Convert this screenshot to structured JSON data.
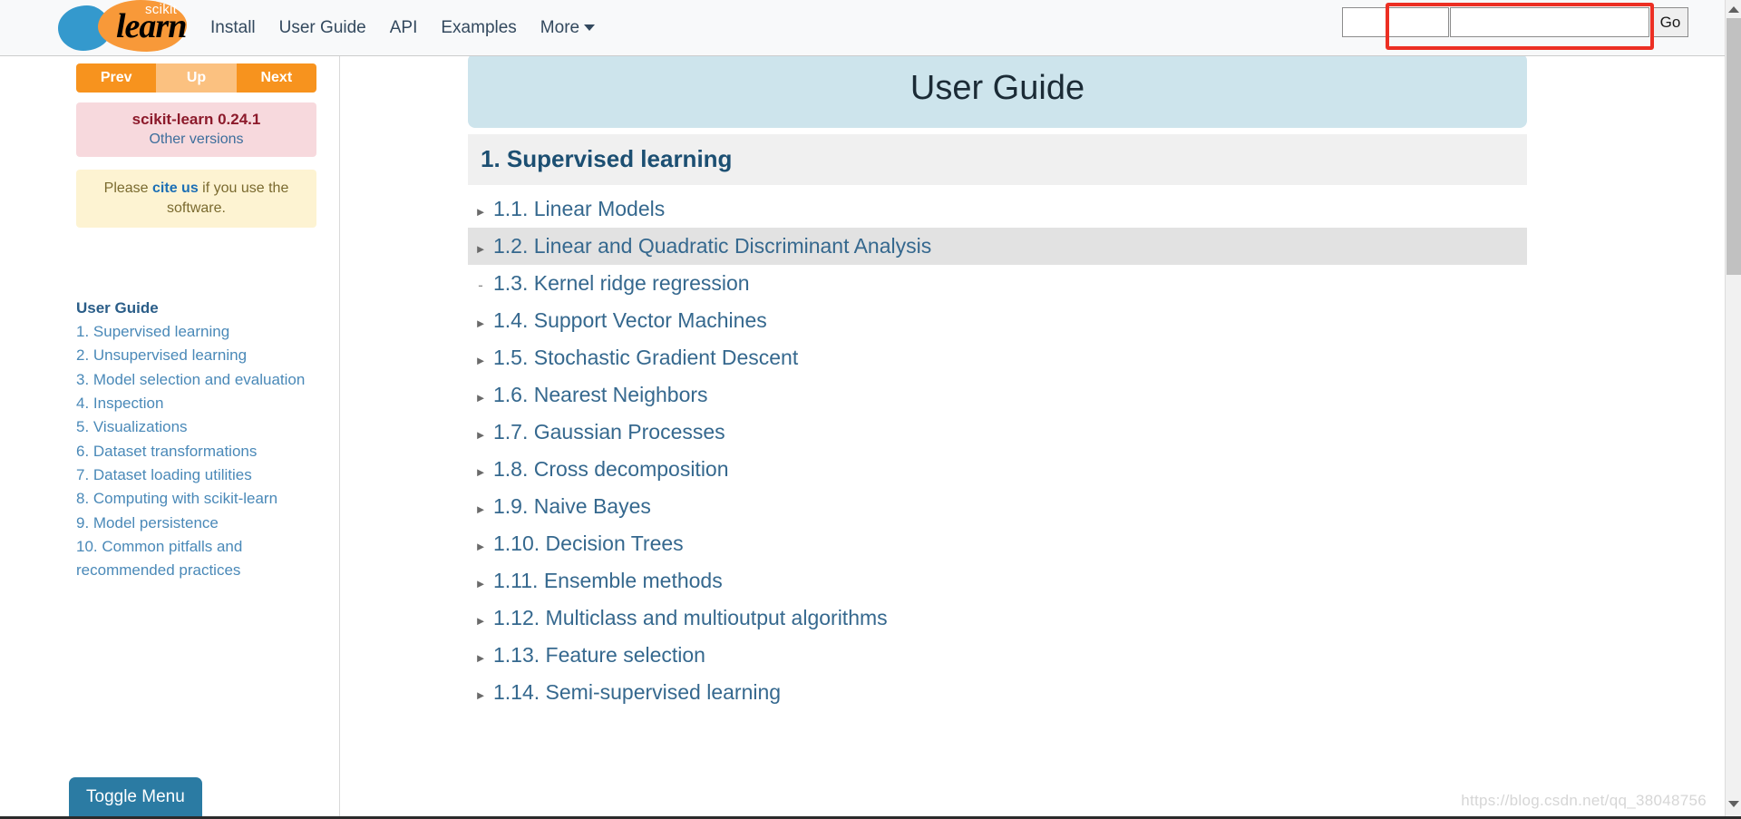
{
  "navbar": {
    "brand": {
      "scikit": "scikit",
      "learn": "learn"
    },
    "links": [
      {
        "label": "Install"
      },
      {
        "label": "User Guide"
      },
      {
        "label": "API"
      },
      {
        "label": "Examples"
      },
      {
        "label": "More"
      }
    ],
    "search": {
      "value": "",
      "placeholder": "",
      "go_label": "Go"
    },
    "annotation_color": "#ec2f23"
  },
  "sidebar": {
    "pager": {
      "prev": "Prev",
      "up": "Up",
      "next": "Next"
    },
    "version": {
      "title": "scikit-learn 0.24.1",
      "other_versions": "Other versions"
    },
    "cite": {
      "before": "Please ",
      "link": "cite us",
      "after": " if you use the software."
    },
    "nav_title": "User Guide",
    "items": [
      {
        "label": "1. Supervised learning"
      },
      {
        "label": "2. Unsupervised learning"
      },
      {
        "label": "3. Model selection and evaluation"
      },
      {
        "label": "4. Inspection"
      },
      {
        "label": "5. Visualizations"
      },
      {
        "label": "6. Dataset transformations"
      },
      {
        "label": "7. Dataset loading utilities"
      },
      {
        "label": "8. Computing with scikit-learn"
      },
      {
        "label": "9. Model persistence"
      },
      {
        "label": "10. Common pitfalls and recommended practices"
      }
    ],
    "toggle_menu": "Toggle Menu"
  },
  "main": {
    "page_title": "User Guide",
    "section_title": "1. Supervised learning",
    "toc": [
      {
        "marker": "►",
        "label": "1.1. Linear Models",
        "active": false
      },
      {
        "marker": "►",
        "label": "1.2. Linear and Quadratic Discriminant Analysis",
        "active": true
      },
      {
        "marker": "-",
        "label": "1.3. Kernel ridge regression",
        "active": false
      },
      {
        "marker": "►",
        "label": "1.4. Support Vector Machines",
        "active": false
      },
      {
        "marker": "►",
        "label": "1.5. Stochastic Gradient Descent",
        "active": false
      },
      {
        "marker": "►",
        "label": "1.6. Nearest Neighbors",
        "active": false
      },
      {
        "marker": "►",
        "label": "1.7. Gaussian Processes",
        "active": false
      },
      {
        "marker": "►",
        "label": "1.8. Cross decomposition",
        "active": false
      },
      {
        "marker": "►",
        "label": "1.9. Naive Bayes",
        "active": false
      },
      {
        "marker": "►",
        "label": "1.10. Decision Trees",
        "active": false
      },
      {
        "marker": "►",
        "label": "1.11. Ensemble methods",
        "active": false
      },
      {
        "marker": "►",
        "label": "1.12. Multiclass and multioutput algorithms",
        "active": false
      },
      {
        "marker": "►",
        "label": "1.13. Feature selection",
        "active": false
      },
      {
        "marker": "►",
        "label": "1.14. Semi-supervised learning",
        "active": false
      }
    ]
  },
  "watermark": "https://blog.csdn.net/qq_38048756"
}
